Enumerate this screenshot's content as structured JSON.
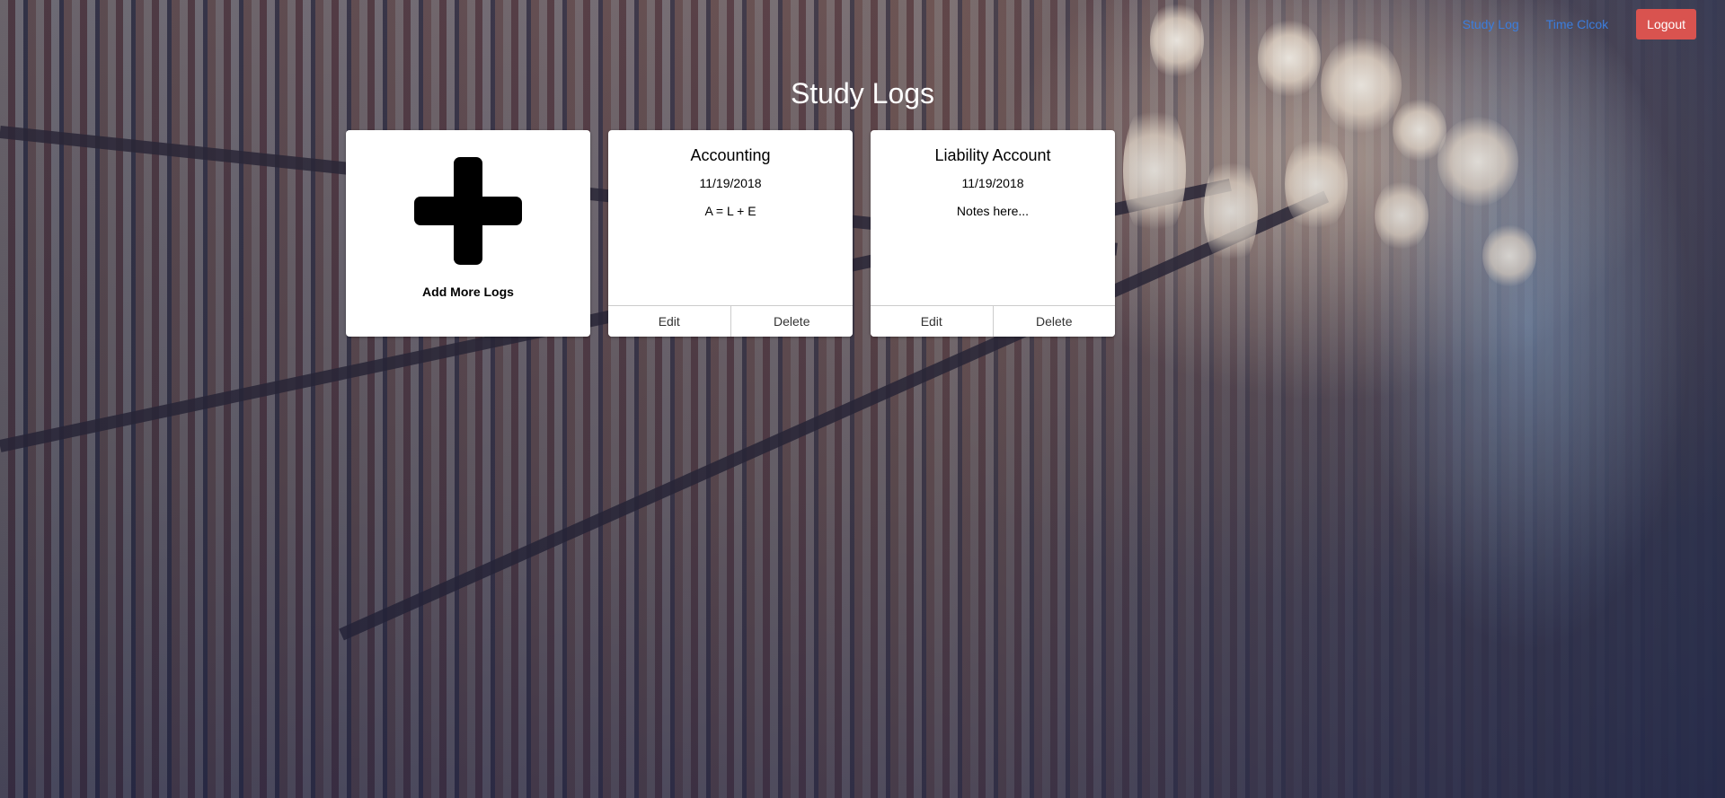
{
  "nav": {
    "study_log": "Study Log",
    "time_clock": "Time Clcok",
    "logout": "Logout"
  },
  "page": {
    "title": "Study Logs"
  },
  "add_card": {
    "label": "Add More Logs",
    "icon": "plus-icon"
  },
  "logs": [
    {
      "title": "Accounting",
      "date": "11/19/2018",
      "notes": "A = L + E",
      "edit_label": "Edit",
      "delete_label": "Delete"
    },
    {
      "title": "Liability Account",
      "date": "11/19/2018",
      "notes": "Notes here...",
      "edit_label": "Edit",
      "delete_label": "Delete"
    }
  ],
  "colors": {
    "link": "#3b7ddd",
    "logout_bg": "#d9534f",
    "card_bg": "#ffffff"
  }
}
